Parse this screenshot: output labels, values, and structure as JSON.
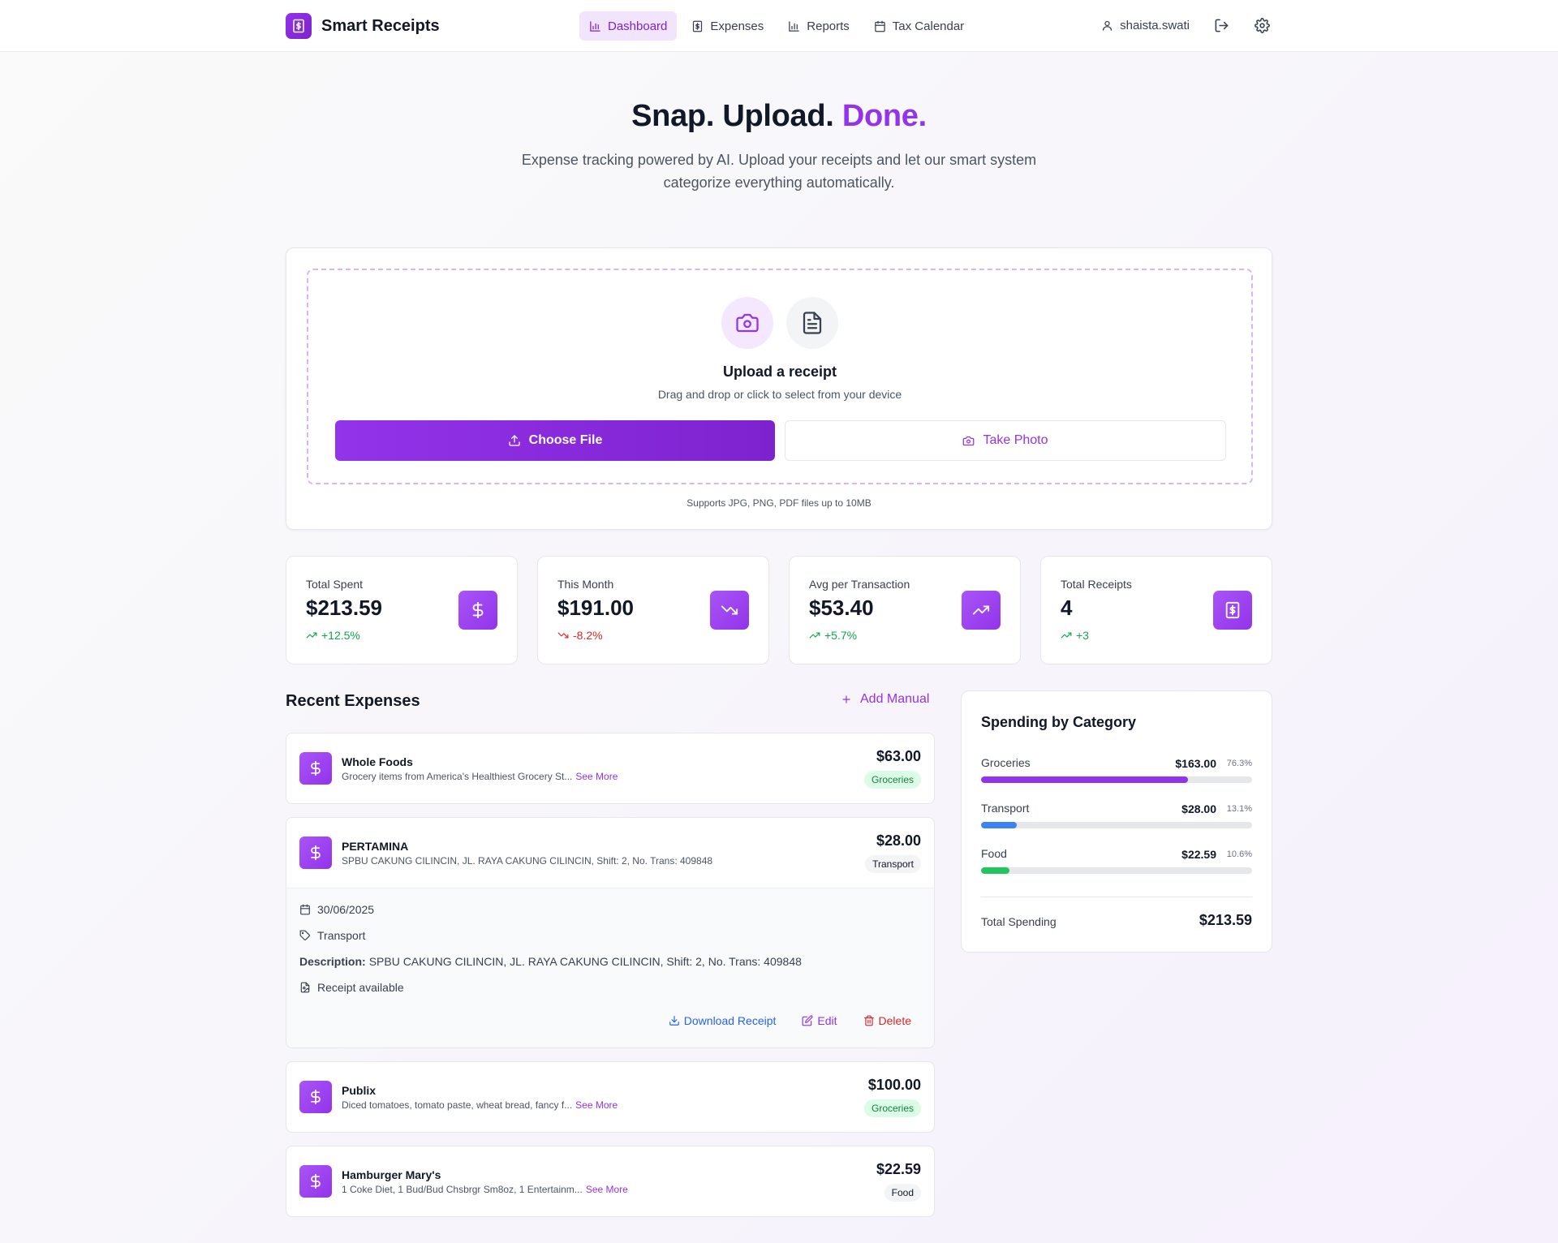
{
  "app": {
    "name": "Smart Receipts",
    "nav": [
      {
        "label": "Dashboard",
        "icon": "bar-chart-icon",
        "active": true
      },
      {
        "label": "Expenses",
        "icon": "receipt-icon",
        "active": false
      },
      {
        "label": "Reports",
        "icon": "bar-chart-icon",
        "active": false
      },
      {
        "label": "Tax Calendar",
        "icon": "calendar-icon",
        "active": false
      }
    ],
    "user": "shaista.swati"
  },
  "hero": {
    "title_main": "Snap. Upload.",
    "title_accent": "Done.",
    "subtitle": "Expense tracking powered by AI. Upload your receipts and let our smart system categorize everything automatically."
  },
  "upload": {
    "title": "Upload a receipt",
    "subtitle": "Drag and drop or click to select from your device",
    "choose_label": "Choose File",
    "photo_label": "Take Photo",
    "supports": "Supports JPG, PNG, PDF files up to 10MB"
  },
  "stats": [
    {
      "label": "Total Spent",
      "value": "$213.59",
      "change": "+12.5%",
      "trend": "up",
      "icon": "dollar-icon"
    },
    {
      "label": "This Month",
      "value": "$191.00",
      "change": "-8.2%",
      "trend": "down",
      "icon": "trending-down-icon"
    },
    {
      "label": "Avg per Transaction",
      "value": "$53.40",
      "change": "+5.7%",
      "trend": "up",
      "icon": "trending-up-icon"
    },
    {
      "label": "Total Receipts",
      "value": "4",
      "change": "+3",
      "trend": "up",
      "icon": "receipt-icon"
    }
  ],
  "expenses": {
    "title": "Recent Expenses",
    "add_label": "Add Manual",
    "see_more": "See More",
    "items": [
      {
        "merchant": "Whole Foods",
        "desc": "Grocery items from America's Healthiest Grocery St...",
        "amount": "$63.00",
        "category": "Groceries"
      },
      {
        "merchant": "PERTAMINA",
        "desc": "SPBU CAKUNG CILINCIN, JL. RAYA CAKUNG CILINCIN, Shift: 2, No. Trans: 409848",
        "amount": "$28.00",
        "category": "Transport"
      },
      {
        "merchant": "Publix",
        "desc": "Diced tomatoes, tomato paste, wheat bread, fancy f...",
        "amount": "$100.00",
        "category": "Groceries"
      },
      {
        "merchant": "Hamburger Mary's",
        "desc": "1 Coke Diet, 1 Bud/Bud Chsbrgr Sm8oz, 1 Entertainm...",
        "amount": "$22.59",
        "category": "Food"
      }
    ],
    "detail": {
      "date": "30/06/2025",
      "category": "Transport",
      "description_label": "Description:",
      "description": "SPBU CAKUNG CILINCIN, JL. RAYA CAKUNG CILINCIN, Shift: 2, No. Trans: 409848",
      "receipt": "Receipt available",
      "download_label": "Download Receipt",
      "edit_label": "Edit",
      "delete_label": "Delete"
    }
  },
  "categories": {
    "title": "Spending by Category",
    "items": [
      {
        "name": "Groceries",
        "amount": "$163.00",
        "percent": "76.3%",
        "fraction": 0.763,
        "color": "#9333ea"
      },
      {
        "name": "Transport",
        "amount": "$28.00",
        "percent": "13.1%",
        "fraction": 0.131,
        "color": "#3b82f6"
      },
      {
        "name": "Food",
        "amount": "$22.59",
        "percent": "10.6%",
        "fraction": 0.106,
        "color": "#22c55e"
      }
    ],
    "total_label": "Total Spending",
    "total_value": "$213.59"
  },
  "colors": {
    "accent": "#9333ea",
    "accent_dark": "#7e22ce",
    "positive": "#16a34a",
    "negative": "#dc2626",
    "link_blue": "#2563eb"
  }
}
